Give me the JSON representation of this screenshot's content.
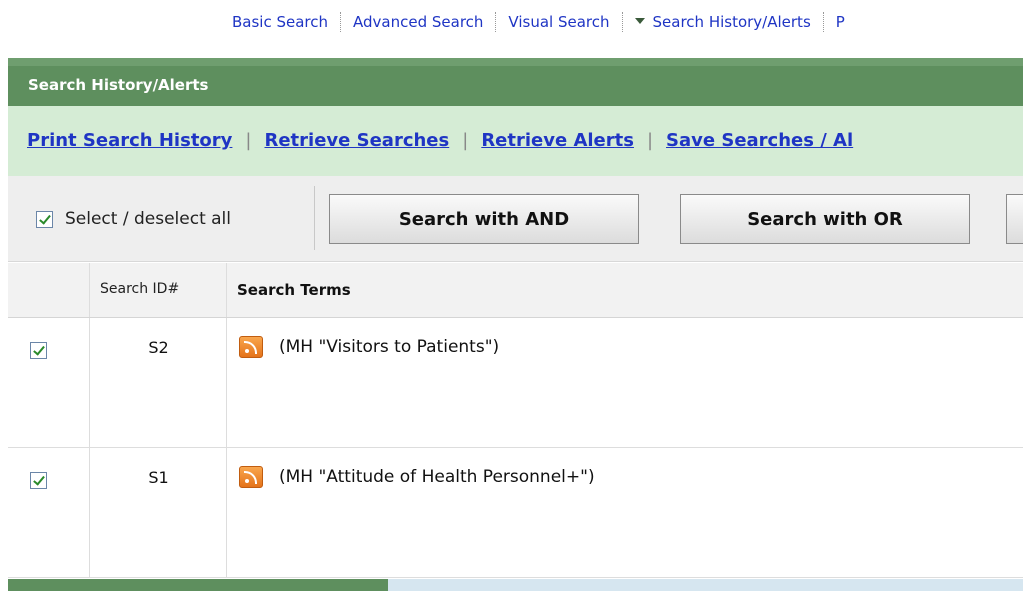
{
  "topnav": {
    "basic_search": "Basic Search",
    "advanced_search": "Advanced Search",
    "visual_search": "Visual Search",
    "search_history": "Search History/Alerts",
    "truncated_link": "P"
  },
  "header": {
    "title": "Search History/Alerts"
  },
  "linkbar": {
    "print": "Print Search History",
    "retrieve_searches": "Retrieve Searches",
    "retrieve_alerts": "Retrieve Alerts",
    "save": "Save Searches / Al",
    "separator": "|"
  },
  "toolbar": {
    "select_all_label": "Select / deselect all",
    "and_button": "Search with AND",
    "or_button": "Search with OR"
  },
  "table": {
    "headers": {
      "id": "Search ID#",
      "terms": "Search Terms"
    },
    "rows": [
      {
        "id": "S2",
        "terms": "(MH \"Visitors to Patients\")",
        "checked": true
      },
      {
        "id": "S1",
        "terms": "(MH \"Attitude of Health Personnel+\")",
        "checked": true
      }
    ]
  },
  "colors": {
    "header_green": "#5e8f5e",
    "linkbar_green": "#d5ecd5",
    "link_blue": "#1f35c4",
    "rss_orange": "#e5731a"
  }
}
